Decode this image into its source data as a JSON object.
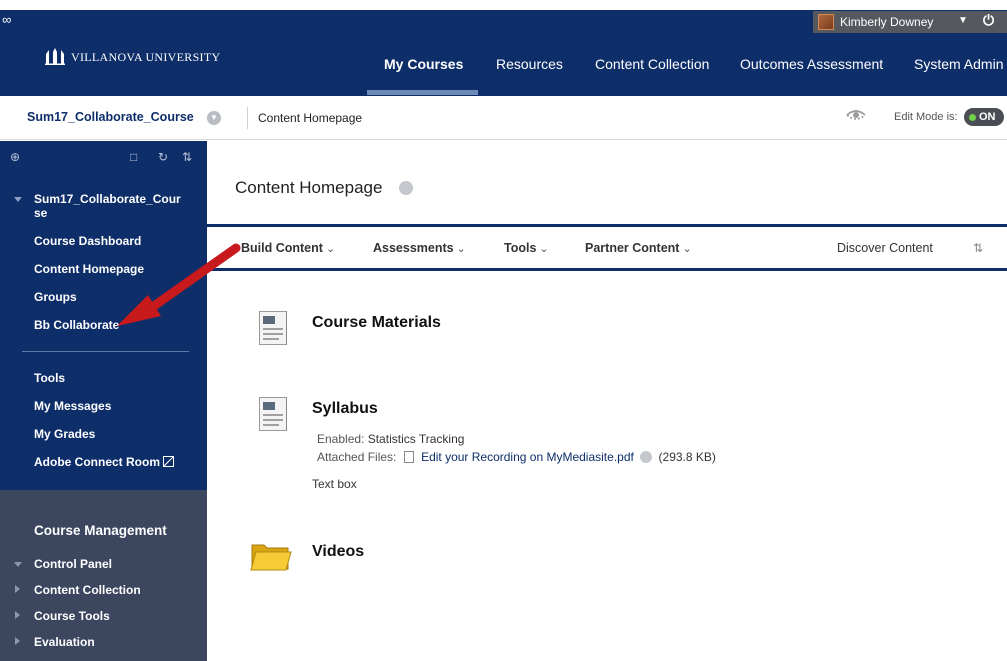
{
  "header": {
    "university": "VILLANOVA UNIVERSITY",
    "user_name": "Kimberly Downey",
    "tabs": [
      {
        "label": "My Courses",
        "active": true
      },
      {
        "label": "Resources"
      },
      {
        "label": "Content Collection"
      },
      {
        "label": "Outcomes Assessment"
      },
      {
        "label": "System Admin"
      }
    ]
  },
  "course_bar": {
    "course_title": "Sum17_Collaborate_Course",
    "breadcrumb": "Content Homepage",
    "edit_mode_label": "Edit Mode is:",
    "edit_mode_value": "ON"
  },
  "sidebar": {
    "course_name": "Sum17_Collaborate_Cour se",
    "items": [
      {
        "label": "Course Dashboard"
      },
      {
        "label": "Content Homepage"
      },
      {
        "label": "Groups"
      },
      {
        "label": "Bb Collaborate"
      }
    ],
    "items2": [
      {
        "label": "Tools"
      },
      {
        "label": "My Messages"
      },
      {
        "label": "My Grades"
      },
      {
        "label": "Adobe Connect Room"
      }
    ],
    "management": {
      "title": "Course Management",
      "items": [
        {
          "label": "Control Panel"
        },
        {
          "label": "Content Collection"
        },
        {
          "label": "Course Tools"
        },
        {
          "label": "Evaluation"
        }
      ]
    }
  },
  "main": {
    "page_title": "Content Homepage",
    "actions": [
      {
        "label": "Build Content"
      },
      {
        "label": "Assessments"
      },
      {
        "label": "Tools"
      },
      {
        "label": "Partner Content"
      }
    ],
    "discover": "Discover Content",
    "items": [
      {
        "title": "Course Materials"
      },
      {
        "title": "Syllabus",
        "enabled_label": "Enabled:",
        "enabled_value": "Statistics Tracking",
        "files_label": "Attached Files:",
        "file_name": "Edit your Recording on MyMediasite.pdf",
        "file_size": "(293.8 KB)",
        "text": "Text box"
      },
      {
        "title": "Videos"
      }
    ]
  },
  "colors": {
    "navy": "#0e2e6a",
    "management_bg": "#3c475f",
    "arrow": "#c8191c",
    "toggle_on": "#6fd04a"
  }
}
